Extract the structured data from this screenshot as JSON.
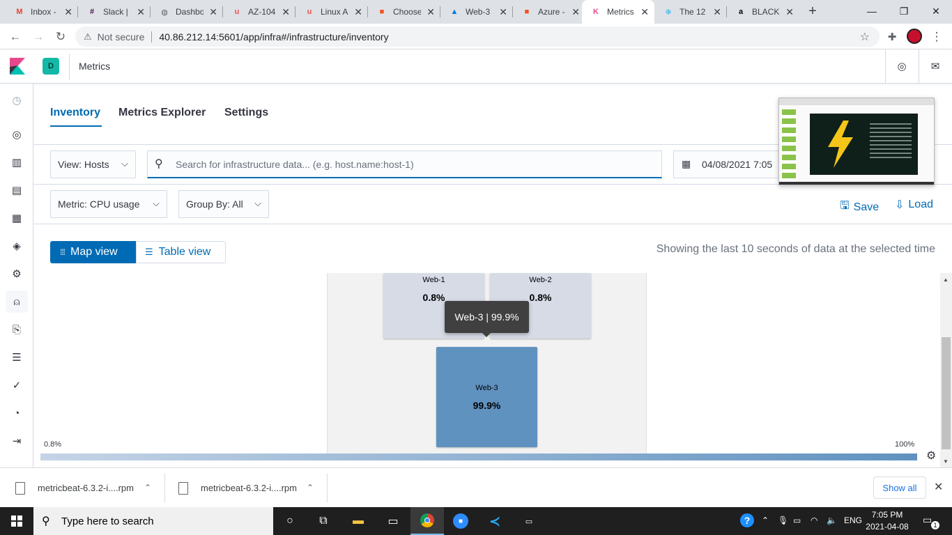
{
  "browser": {
    "tabs": [
      {
        "title": "Inbox -",
        "favicon": "gmail-icon",
        "color": "#ea4335",
        "glyph": "M"
      },
      {
        "title": "Slack |",
        "favicon": "slack-icon",
        "color": "#4a154b",
        "glyph": "#"
      },
      {
        "title": "Dashbo",
        "favicon": "globe-icon",
        "color": "#5f6368",
        "glyph": "◍"
      },
      {
        "title": "AZ-104",
        "favicon": "udemy-icon",
        "color": "#ec5252",
        "glyph": "u"
      },
      {
        "title": "Linux A",
        "favicon": "udemy-icon",
        "color": "#ec5252",
        "glyph": "u"
      },
      {
        "title": "Choose",
        "favicon": "microsoft-icon",
        "color": "#f25022",
        "glyph": "■"
      },
      {
        "title": "Web-3",
        "favicon": "azure-icon",
        "color": "#0078d4",
        "glyph": "▲"
      },
      {
        "title": "Azure -",
        "favicon": "microsoft-icon",
        "color": "#f25022",
        "glyph": "■"
      },
      {
        "title": "Metrics",
        "favicon": "kibana-icon",
        "color": "#e8488b",
        "glyph": "K"
      },
      {
        "title": "The 12",
        "favicon": "snowflake-icon",
        "color": "#29b5e8",
        "glyph": "❄"
      },
      {
        "title": "BLACK",
        "favicon": "amazon-icon",
        "color": "#000000",
        "glyph": "a"
      }
    ],
    "active_tab_index": 8,
    "security_label": "Not secure",
    "url": "40.86.212.14:5601/app/infra#/infrastructure/inventory"
  },
  "kibana": {
    "space_initial": "D",
    "app_name": "Metrics"
  },
  "page": {
    "tabs": [
      "Inventory",
      "Metrics Explorer",
      "Settings"
    ],
    "active_tab": "Inventory",
    "view_select": "View: Hosts",
    "search_placeholder": "Search for infrastructure data... (e.g. host.name:host-1)",
    "date_value": "04/08/2021 7:05",
    "metric_select": "Metric: CPU usage",
    "groupby_select": "Group By: All",
    "save_label": "Save",
    "load_label": "Load",
    "map_view_label": "Map view",
    "table_view_label": "Table view",
    "showing_text": "Showing the last 10 seconds of data at the selected time"
  },
  "hosts": [
    {
      "name": "Web-1",
      "value": "0.8%",
      "fill": "#d6dbe6"
    },
    {
      "name": "Web-2",
      "value": "0.8%",
      "fill": "#d6dbe6"
    },
    {
      "name": "Web-3",
      "value": "99.9%",
      "fill": "#6092c0"
    }
  ],
  "tooltip": {
    "text": "Web-3 | 99.9%"
  },
  "legend": {
    "min": "0.8%",
    "max": "100%",
    "min_color": "#c5d4e6",
    "max_color": "#6092c0"
  },
  "downloads": {
    "items": [
      "metricbeat-6.3.2-i....rpm",
      "metricbeat-6.3.2-i....rpm"
    ],
    "show_all_label": "Show all"
  },
  "taskbar": {
    "search_placeholder": "Type here to search",
    "language": "ENG",
    "time": "7:05 PM",
    "date": "2021-04-08",
    "notification_count": "1"
  }
}
